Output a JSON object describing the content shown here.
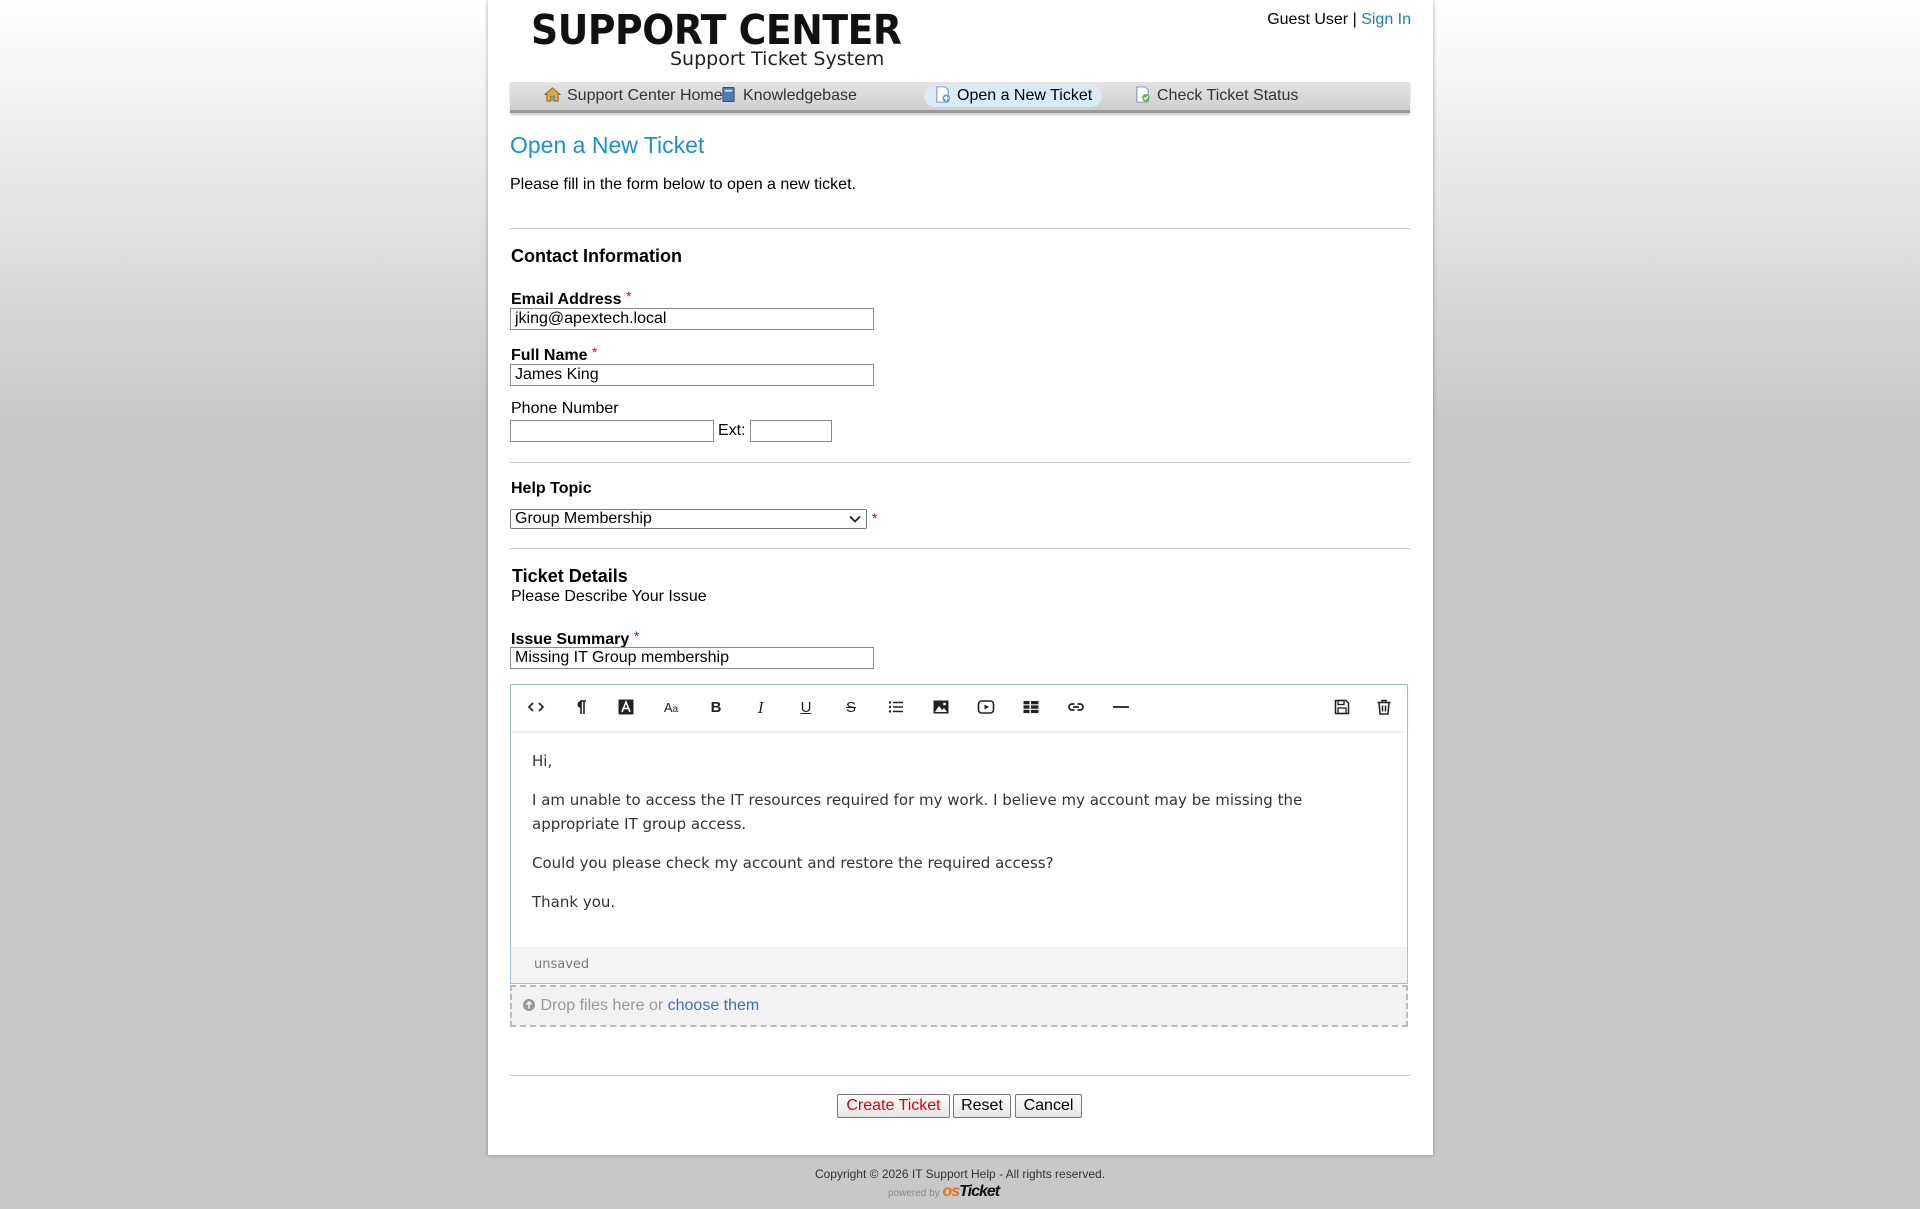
{
  "header": {
    "logo_title": "SUPPORT CENTER",
    "logo_subtitle": "Support Ticket System",
    "user_label": "Guest User",
    "separator": "|",
    "sign_in": "Sign In"
  },
  "nav": {
    "items": [
      {
        "label": "Support Center Home",
        "icon": "home-icon"
      },
      {
        "label": "Knowledgebase",
        "icon": "book-icon"
      },
      {
        "label": "Open a New Ticket",
        "icon": "new-ticket-icon"
      },
      {
        "label": "Check Ticket Status",
        "icon": "ticket-status-icon"
      }
    ],
    "active": "Open a New Ticket"
  },
  "page": {
    "title": "Open a New Ticket",
    "intro": "Please fill in the form below to open a new ticket."
  },
  "contact": {
    "heading": "Contact Information",
    "email_label": "Email Address",
    "email_value": "jking@apextech.local",
    "name_label": "Full Name",
    "name_value": "James King",
    "phone_label": "Phone Number",
    "phone_value": "",
    "ext_label": "Ext:",
    "ext_value": "",
    "required_mark": "*"
  },
  "help_topic": {
    "label": "Help Topic",
    "selected": "Group Membership"
  },
  "details": {
    "heading": "Ticket Details",
    "subheading": "Please Describe Your Issue",
    "summary_label": "Issue Summary",
    "summary_value": "Missing IT Group membership"
  },
  "editor": {
    "toolbar": [
      "code-icon",
      "paragraph-icon",
      "font-color-icon",
      "font-size-icon",
      "bold-icon",
      "italic-icon",
      "underline-icon",
      "strikethrough-icon",
      "list-icon",
      "image-icon",
      "video-icon",
      "table-icon",
      "link-icon",
      "horizontal-rule-icon",
      "save-icon",
      "delete-icon"
    ],
    "paragraphs": [
      "Hi,",
      "I am unable to access the IT resources required for my work. I believe my account may be missing the appropriate IT group access.",
      "Could you please check my account and restore the required access?",
      "Thank you."
    ],
    "status": "unsaved"
  },
  "attachments": {
    "text": "Drop files here or",
    "link": "choose them"
  },
  "buttons": {
    "create": "Create Ticket",
    "reset": "Reset",
    "cancel": "Cancel"
  },
  "footer": {
    "copyright": "Copyright © 2026 IT Support Help - All rights reserved.",
    "powered_by": "powered by",
    "brand_os": "os",
    "brand_ticket": "Ticket"
  },
  "colors": {
    "accent": "#1c8fd8",
    "link": "#1a7bd1",
    "required": "#e00000",
    "create_button_text": "#e00000"
  }
}
